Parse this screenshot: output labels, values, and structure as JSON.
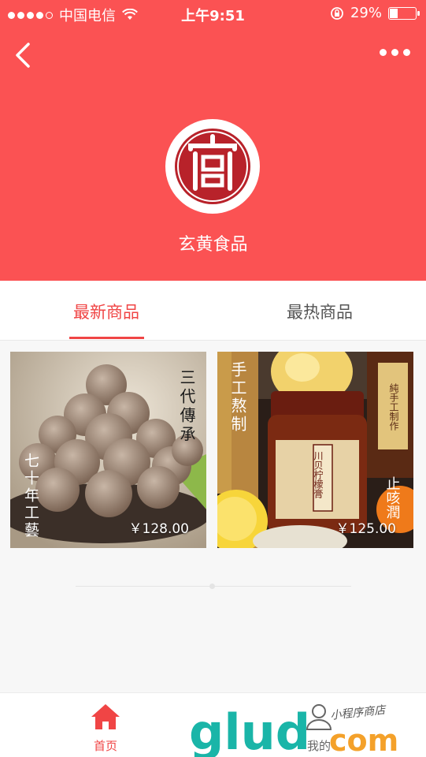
{
  "status_bar": {
    "carrier": "中国电信",
    "time": "上午9:51",
    "battery": "29%",
    "battery_level": 0.29
  },
  "header": {
    "shop_name": "玄黄食品",
    "background_color": "#fb5253"
  },
  "tabs": [
    {
      "label": "最新商品",
      "active": true
    },
    {
      "label": "最热商品",
      "active": false
    }
  ],
  "products": [
    {
      "price": "￥128.00",
      "image_text_right": "三代傳承",
      "image_text_left": "七十年工藝"
    },
    {
      "price": "￥125.00",
      "image_text_left": "手工熬制",
      "image_text_right_top": "純手工制作",
      "image_text_right_bottom": "止咳潤",
      "jar_label": "川贝柠檬膏"
    }
  ],
  "tabbar": {
    "home_label": "首页",
    "mine_label": "我的"
  },
  "watermark": {
    "brand": "glud",
    "domain": "com",
    "tagline": "小程序商店"
  },
  "colors": {
    "accent": "#f04545",
    "brand_red": "#fb5253",
    "watermark_teal": "#1ab5a8",
    "watermark_orange": "#f4a12a"
  }
}
